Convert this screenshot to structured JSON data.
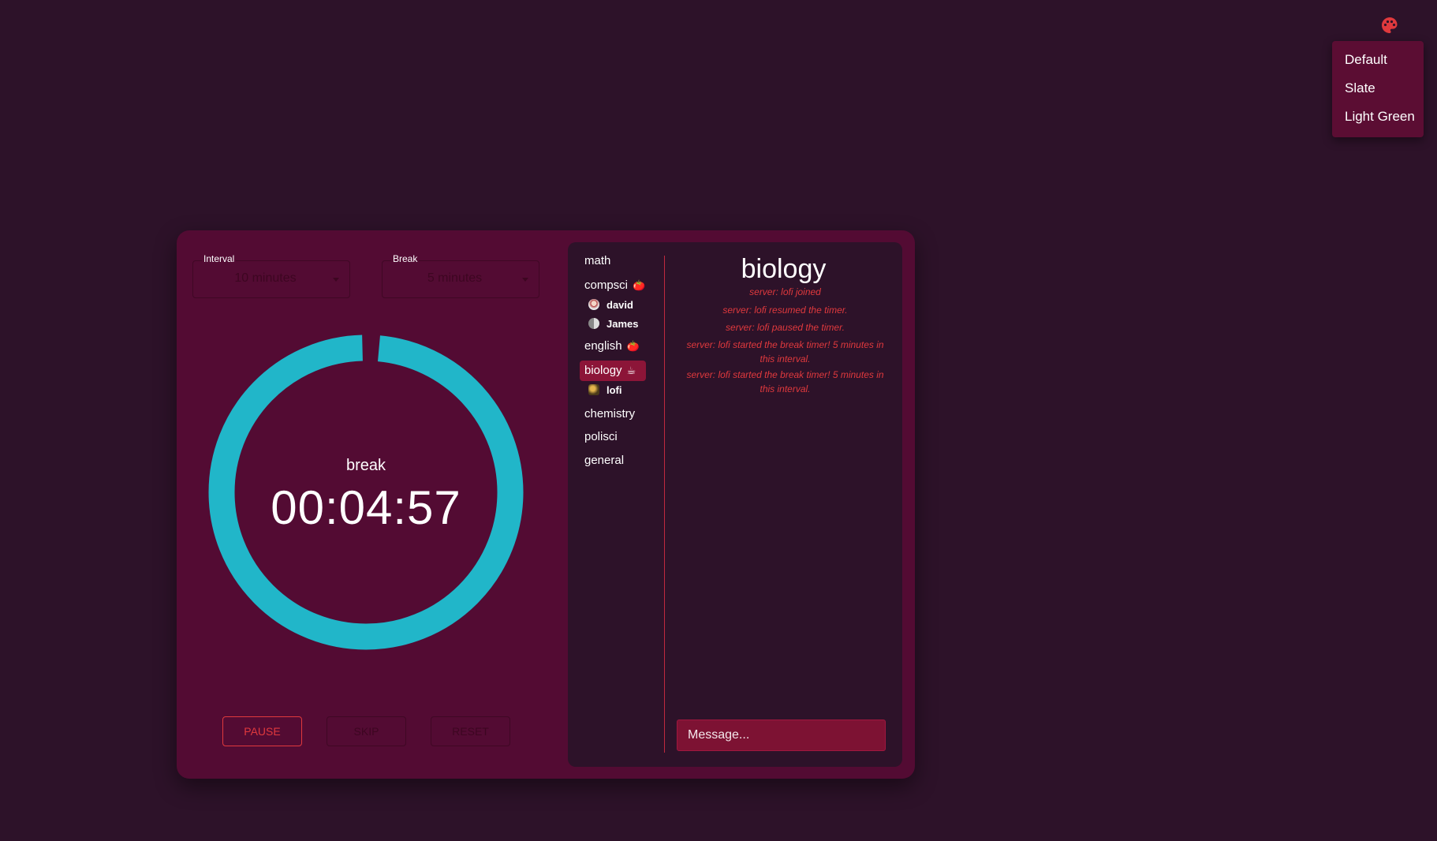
{
  "theme_menu": {
    "icon": "palette-icon",
    "icon_color": "#e0393d",
    "options": [
      "Default",
      "Slate",
      "Light Green"
    ]
  },
  "timer": {
    "interval_label": "Interval",
    "interval_value": "10 minutes",
    "break_label": "Break",
    "break_value": "5 minutes",
    "phase": "break",
    "time": "00:04:57",
    "progress_fraction": 0.99,
    "ring_color": "#21b6c9",
    "buttons": {
      "pause": "PAUSE",
      "skip": "SKIP",
      "reset": "RESET"
    }
  },
  "rooms": [
    {
      "name": "math",
      "emoji": "",
      "active": false,
      "users": []
    },
    {
      "name": "compsci",
      "emoji": "🍅",
      "active": false,
      "users": [
        "david",
        "James"
      ]
    },
    {
      "name": "english",
      "emoji": "🍅",
      "active": false,
      "users": []
    },
    {
      "name": "biology",
      "emoji": "☕",
      "active": true,
      "users": [
        "lofi"
      ]
    },
    {
      "name": "chemistry",
      "emoji": "",
      "active": false,
      "users": []
    },
    {
      "name": "polisci",
      "emoji": "",
      "active": false,
      "users": []
    },
    {
      "name": "general",
      "emoji": "",
      "active": false,
      "users": []
    }
  ],
  "chat": {
    "title": "biology",
    "messages": [
      "server: lofi joined",
      "server: lofi resumed the timer.",
      "server: lofi paused the timer.",
      "server: lofi started the break timer! 5 minutes in this interval.",
      "server: lofi started the break timer! 5 minutes in this interval."
    ],
    "input_placeholder": "Message..."
  }
}
